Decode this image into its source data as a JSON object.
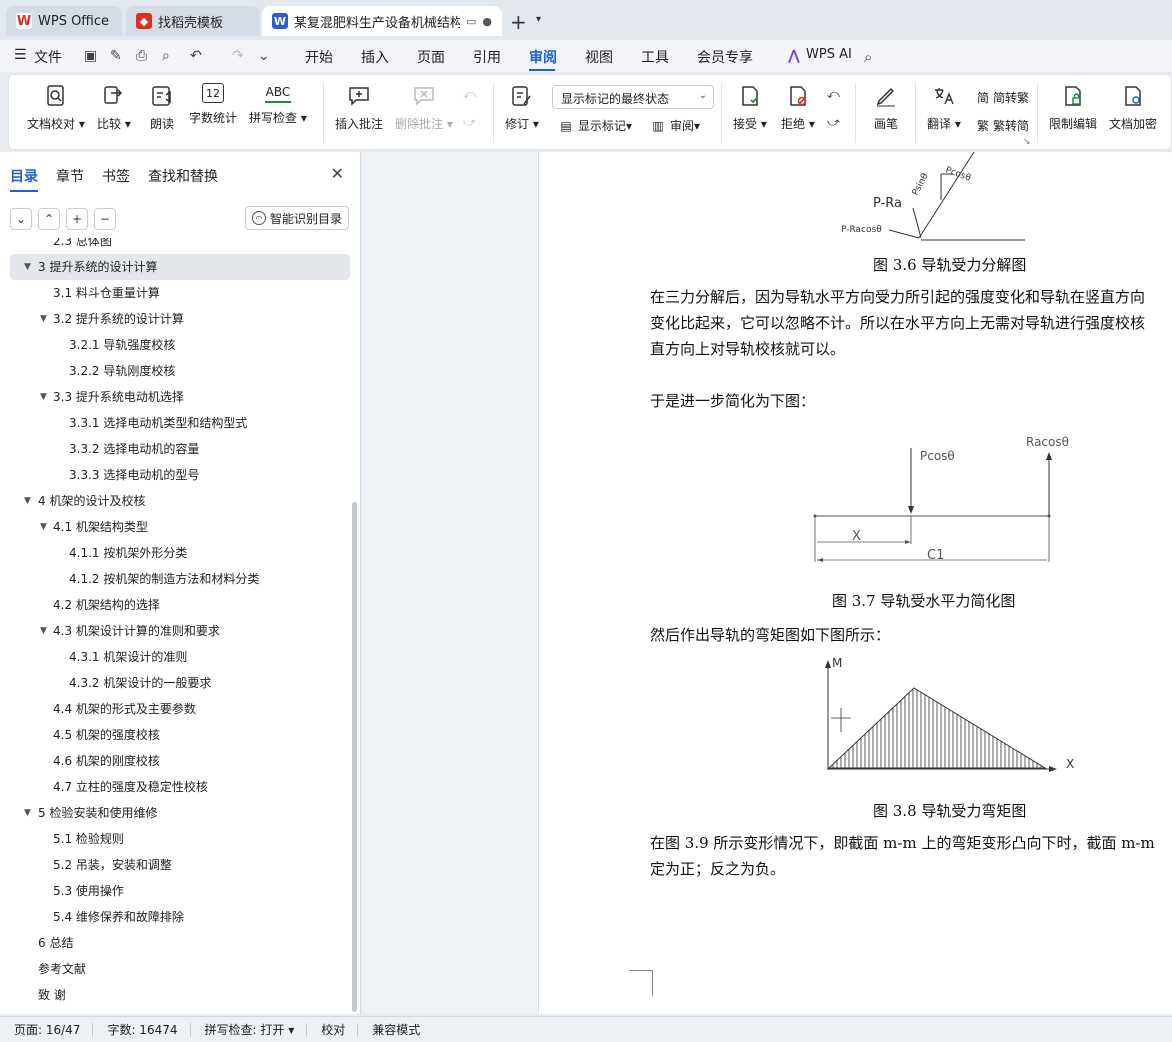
{
  "tabs": [
    {
      "label": "WPS Office"
    },
    {
      "label": "找稻壳模板"
    },
    {
      "label": "某复混肥料生产设备机械结构"
    }
  ],
  "menu": {
    "file": "文件",
    "items": [
      "开始",
      "插入",
      "页面",
      "引用",
      "审阅",
      "视图",
      "工具",
      "会员专享"
    ],
    "active": "审阅",
    "wps_ai": "WPS AI"
  },
  "ribbon": {
    "doc_check": "文档校对",
    "compare": "比较",
    "read_aloud": "朗读",
    "word_count": "字数统计",
    "spell_check": "拼写检查",
    "spell_check_icon_text": "ABC",
    "word_count_icon_text": "12",
    "insert_comment": "插入批注",
    "delete_comment": "删除批注",
    "track_changes": "修订",
    "markup_state": "显示标记的最终状态",
    "show_markup": "显示标记",
    "review": "审阅",
    "accept": "接受",
    "reject": "拒绝",
    "pen": "画笔",
    "translate": "翻译",
    "to_traditional": "简转繁",
    "to_simplified": "繁转简",
    "restrict_edit": "限制编辑",
    "encrypt": "文档加密"
  },
  "sidebar": {
    "tabs": [
      "目录",
      "章节",
      "书签",
      "查找和替换"
    ],
    "smart_toc": "智能识别目录",
    "toc": [
      {
        "label": "2.3 总体图",
        "level": 2,
        "expand": false
      },
      {
        "label": "3 提升系统的设计计算",
        "level": 1,
        "expand": true,
        "selected": true
      },
      {
        "label": "3.1 料斗仓重量计算",
        "level": 2,
        "expand": false
      },
      {
        "label": "3.2 提升系统的设计计算",
        "level": 2,
        "expand": true
      },
      {
        "label": "3.2.1 导轨强度校核",
        "level": 3,
        "expand": false
      },
      {
        "label": "3.2.2 导轨刚度校核",
        "level": 3,
        "expand": false
      },
      {
        "label": "3.3 提升系统电动机选择",
        "level": 2,
        "expand": true
      },
      {
        "label": "3.3.1   选择电动机类型和结构型式",
        "level": 3,
        "expand": false
      },
      {
        "label": "3.3.2 选择电动机的容量",
        "level": 3,
        "expand": false
      },
      {
        "label": "3.3.3 选择电动机的型号",
        "level": 3,
        "expand": false
      },
      {
        "label": "4 机架的设计及校核",
        "level": 1,
        "expand": true
      },
      {
        "label": "4.1 机架结构类型",
        "level": 2,
        "expand": true
      },
      {
        "label": "4.1.1 按机架外形分类",
        "level": 3,
        "expand": false
      },
      {
        "label": "4.1.2 按机架的制造方法和材料分类",
        "level": 3,
        "expand": false
      },
      {
        "label": "4.2 机架结构的选择",
        "level": 2,
        "expand": false
      },
      {
        "label": "4.3 机架设计计算的准则和要求",
        "level": 2,
        "expand": true
      },
      {
        "label": "4.3.1 机架设计的准则",
        "level": 3,
        "expand": false
      },
      {
        "label": "4.3.2 机架设计的一般要求",
        "level": 3,
        "expand": false
      },
      {
        "label": "4.4 机架的形式及主要参数",
        "level": 2,
        "expand": false
      },
      {
        "label": "4.5 机架的强度校核",
        "level": 2,
        "expand": false
      },
      {
        "label": "4.6 机架的刚度校核",
        "level": 2,
        "expand": false
      },
      {
        "label": "4.7 立柱的强度及稳定性校核",
        "level": 2,
        "expand": false
      },
      {
        "label": "5 检验安装和使用维修",
        "level": 1,
        "expand": true
      },
      {
        "label": "5.1 检验规则",
        "level": 2,
        "expand": false
      },
      {
        "label": "5.2 吊装，安装和调整",
        "level": 2,
        "expand": false
      },
      {
        "label": "5.3 使用操作",
        "level": 2,
        "expand": false
      },
      {
        "label": "5.4 维修保养和故障排除",
        "level": 2,
        "expand": false
      },
      {
        "label": "6 总结",
        "level": 1,
        "expand": false
      },
      {
        "label": "参考文献",
        "level": 1,
        "expand": false
      },
      {
        "label": "致    谢",
        "level": 1,
        "expand": false
      }
    ]
  },
  "document": {
    "fig36_labels": {
      "p_ra": "P-Ra",
      "p_racos": "P-Racosθ",
      "psin": "Psinθ",
      "pcos": "Pcosθ"
    },
    "fig36_caption": "图 3.6 导轨受力分解图",
    "para1": [
      "在三力分解后，因为导轨水平方向受力所引起的强度变化和导轨在竖直方向",
      "变化比起来，它可以忽略不计。所以在水平方向上无需对导轨进行强度校核",
      "直方向上对导轨校核就可以。"
    ],
    "para2": "于是进一步简化为下图：",
    "fig37_labels": {
      "pcos": "Pcosθ",
      "racos": "Racosθ",
      "x": "X",
      "c1": "C1"
    },
    "fig37_caption": "图 3.7 导轨受水平力简化图",
    "para3": "然后作出导轨的弯矩图如下图所示：",
    "fig38_labels": {
      "m": "M",
      "x": "X"
    },
    "fig38_caption": "图 3.8 导轨受力弯矩图",
    "para4": [
      "在图 3.9 所示变形情况下，即截面 m-m 上的弯矩变形凸向下时，截面 m-m",
      "定为正；反之为负。"
    ]
  },
  "status": {
    "page": "页面: 16/47",
    "words": "字数: 16474",
    "spell": "拼写检查: 打开",
    "proof": "校对",
    "compat": "兼容模式"
  },
  "colors": {
    "accent": "#1d5fd6",
    "wps_red": "#d93025",
    "doc_blue": "#2b5bd7"
  }
}
